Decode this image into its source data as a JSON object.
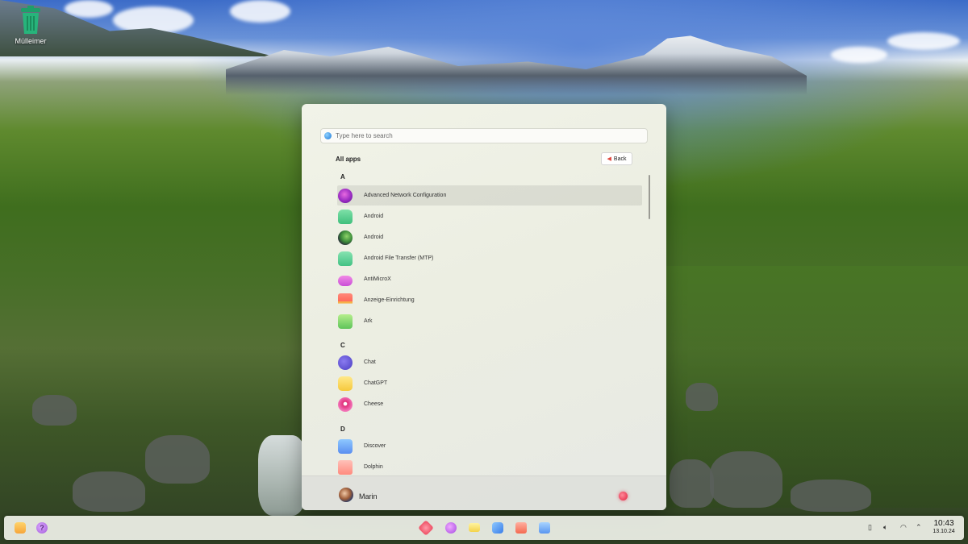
{
  "desktop": {
    "trash_label": "Mülleimer"
  },
  "launcher": {
    "search_placeholder": "Type here to search",
    "all_apps_label": "All apps",
    "back_label": "Back",
    "sections": [
      {
        "letter": "A"
      },
      {
        "letter": "C"
      },
      {
        "letter": "D"
      }
    ],
    "apps": [
      {
        "name": "Advanced Network Configuration",
        "icon": "network-config-icon",
        "selected": true
      },
      {
        "name": "Android",
        "icon": "android-icon"
      },
      {
        "name": "Android",
        "icon": "android-studio-icon"
      },
      {
        "name": "Android File Transfer (MTP)",
        "icon": "android-file-transfer-icon"
      },
      {
        "name": "AntiMicroX",
        "icon": "gamepad-icon"
      },
      {
        "name": "Anzeige-Einrichtung",
        "icon": "display-settings-icon"
      },
      {
        "name": "Ark",
        "icon": "ark-archive-icon"
      },
      {
        "name": "Chat",
        "icon": "chat-icon"
      },
      {
        "name": "ChatGPT",
        "icon": "chatgpt-icon"
      },
      {
        "name": "Cheese",
        "icon": "cheese-webcam-icon"
      },
      {
        "name": "Discover",
        "icon": "discover-icon"
      },
      {
        "name": "Dolphin",
        "icon": "dolphin-folder-icon"
      }
    ],
    "user_name": "Marin"
  },
  "taskbar": {
    "time": "10:43",
    "date": "13.10.24",
    "left_icons": [
      "file-manager-icon",
      "help-icon"
    ],
    "center_icons": [
      "app-launcher-icon",
      "search-icon",
      "notes-icon",
      "multitasking-icon",
      "files-icon",
      "store-icon"
    ],
    "tray_icons": [
      "battery-icon",
      "volume-icon",
      "wifi-icon",
      "chevron-up-icon"
    ]
  }
}
